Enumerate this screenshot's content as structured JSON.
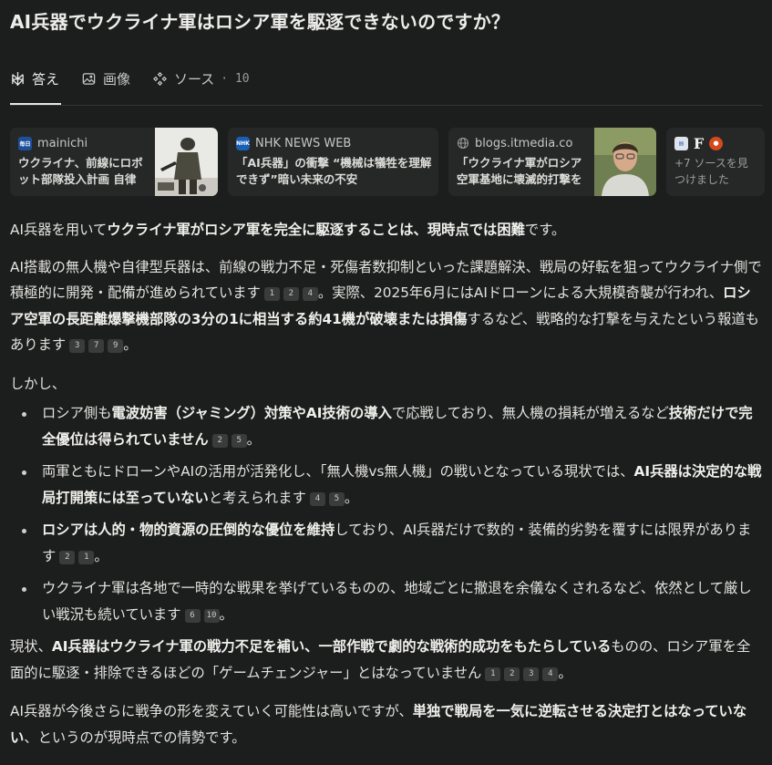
{
  "title": "AI兵器でウクライナ軍はロシア軍を駆逐できないのですか？",
  "tabs": [
    {
      "label": "答え",
      "icon": "perplexity-icon"
    },
    {
      "label": "画像",
      "icon": "image-icon"
    },
    {
      "label": "ソース",
      "icon": "sources-icon",
      "count": "· 10"
    }
  ],
  "sources": [
    {
      "site": "mainichi",
      "title": "ウクライナ、前線にロボット部隊投入計画 自律型…"
    },
    {
      "site": "NHK NEWS WEB",
      "title": "「AI兵器」の衝撃 “機械は犠牲を理解できず”暗い未来の不安"
    },
    {
      "site": "blogs.itmedia.co",
      "title": "「ウクライナ軍がロシア空軍基地に壊滅的打撃を与…"
    },
    {
      "site": "",
      "title": "+7 ソースを見つけました"
    }
  ],
  "colors": {
    "background": "#1c1d1d",
    "card": "#262828",
    "text": "#e3e3df",
    "cite": "#3a3c3c"
  },
  "p1": {
    "a": "AI兵器を用いて",
    "b": "ウクライナ軍がロシア軍を完全に駆逐することは、現時点では困難",
    "c": "です。"
  },
  "p2": {
    "a": "AI搭載の無人機や自律型兵器は、前線の戦力不足・死傷者数抑制といった課題解決、戦局の好転を狙ってウクライナ側で積極的に開発・配備が進められています",
    "cites1": [
      "1",
      "2",
      "4"
    ],
    "b": "。実際、2025年6月にはAIドローンによる大規模奇襲が行われ、",
    "c": "ロシア空軍の長距離爆撃機部隊の3分の1に相当する約41機が破壊または損傷",
    "d": "するなど、戦略的な打撃を与えたという報道もあります",
    "cites2": [
      "3",
      "7",
      "9"
    ],
    "e": "。"
  },
  "p3": "しかし、",
  "b1": {
    "a": "ロシア側も",
    "b": "電波妨害（ジャミング）対策やAI技術の導入",
    "c": "で応戦しており、無人機の損耗が増えるなど",
    "d": "技術だけで完全優位は得られていません",
    "cites": [
      "2",
      "5"
    ],
    "e": "。"
  },
  "b2": {
    "a": "両軍ともにドローンやAIの活用が活発化し、「無人機vs無人機」の戦いとなっている現状では、",
    "b": "AI兵器は決定的な戦局打開策には至っていない",
    "c": "と考えられます",
    "cites": [
      "4",
      "5"
    ],
    "e": "。"
  },
  "b3": {
    "b": "ロシアは人的・物的資源の圧倒的な優位を維持",
    "c": "しており、AI兵器だけで数的・装備的劣勢を覆すには限界があります",
    "cites": [
      "2",
      "1"
    ],
    "e": "。"
  },
  "b4": {
    "a": "ウクライナ軍は各地で一時的な戦果を挙げているものの、地域ごとに撤退を余儀なくされるなど、依然として厳しい戦況も続いています",
    "cites": [
      "6",
      "10"
    ],
    "e": "。"
  },
  "p4": {
    "a": "現状、",
    "b": "AI兵器はウクライナ軍の戦力不足を補い、一部作戦で劇的な戦術的成功をもたらしている",
    "c": "ものの、ロシア軍を全面的に駆逐・排除できるほどの「ゲームチェンジャー」とはなっていません",
    "cites": [
      "1",
      "2",
      "3",
      "4"
    ],
    "e": "。"
  },
  "p5": {
    "a": "AI兵器が今後さらに戦争の形を変えていく可能性は高いですが、",
    "b": "単独で戦局を一気に逆転させる決定打とはなっていない",
    "c": "、というのが現時点での情勢です。"
  }
}
